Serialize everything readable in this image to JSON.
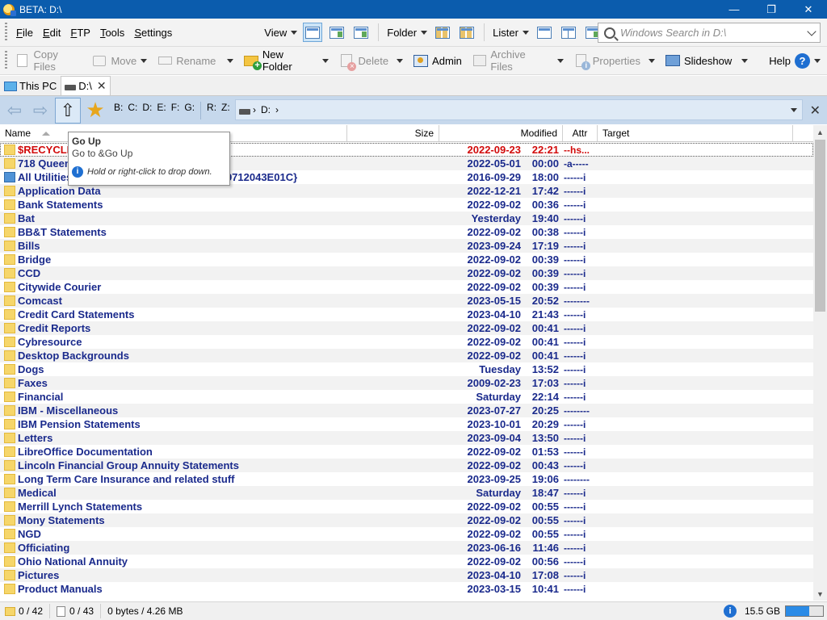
{
  "window": {
    "title": "BETA: D:\\",
    "controls": [
      "—",
      "❐",
      "✕"
    ]
  },
  "menu": {
    "items": [
      {
        "label": "File",
        "hot": "F",
        "rest": "ile"
      },
      {
        "label": "Edit",
        "hot": "E",
        "rest": "dit"
      },
      {
        "label": "FTP",
        "hot": "F",
        "rest": "TP"
      },
      {
        "label": "Tools",
        "hot": "T",
        "rest": "ools"
      },
      {
        "label": "Settings",
        "hot": "S",
        "rest": "ettings"
      }
    ],
    "view_label": "View",
    "folder_label": "Folder",
    "lister_label": "Lister",
    "search_placeholder": "Windows Search in D:\\"
  },
  "operations": {
    "copy": "Copy Files",
    "move": "Move",
    "rename": "Rename",
    "new_folder": "New Folder",
    "delete": "Delete",
    "admin": "Admin",
    "archive": "Archive Files",
    "properties": "Properties",
    "slideshow": "Slideshow",
    "help": "Help"
  },
  "tabs": [
    {
      "label": "This PC",
      "icon": "pc-icon",
      "active": false
    },
    {
      "label": "D:\\",
      "icon": "drive-icon",
      "active": true
    }
  ],
  "location": {
    "drives": [
      "B:",
      "C:",
      "D:",
      "E:",
      "F:",
      "G:",
      "R:",
      "Z:"
    ],
    "path": "D:"
  },
  "columns": {
    "name": "Name",
    "size": "Size",
    "modified": "Modified",
    "attr": "Attr",
    "target": "Target"
  },
  "tooltip": {
    "title": "Go Up",
    "subtitle": "Go to &Go Up",
    "hint": "Hold or right-click to drop down."
  },
  "files": [
    {
      "name": "$RECYCLE.BIN",
      "date": "2022-09-23",
      "time": "22:21",
      "attr": "--hs...",
      "kind": "recycle"
    },
    {
      "name": "718 Queen",
      "date": "2022-05-01",
      "time": "00:00",
      "attr": "-a-----",
      "kind": "folder"
    },
    {
      "name": "All Utilities.{ED7BA470-8E54-465E-825C-99712043E01C}",
      "date": "2016-09-29",
      "time": "18:00",
      "attr": "------i",
      "kind": "system"
    },
    {
      "name": "Application Data",
      "date": "2022-12-21",
      "time": "17:42",
      "attr": "------i",
      "kind": "folder"
    },
    {
      "name": "Bank Statements",
      "date": "2022-09-02",
      "time": "00:36",
      "attr": "------i",
      "kind": "folder"
    },
    {
      "name": "Bat",
      "date": "Yesterday",
      "time": "19:40",
      "attr": "------i",
      "kind": "folder"
    },
    {
      "name": "BB&T Statements",
      "date": "2022-09-02",
      "time": "00:38",
      "attr": "------i",
      "kind": "folder"
    },
    {
      "name": "Bills",
      "date": "2023-09-24",
      "time": "17:19",
      "attr": "------i",
      "kind": "folder"
    },
    {
      "name": "Bridge",
      "date": "2022-09-02",
      "time": "00:39",
      "attr": "------i",
      "kind": "folder"
    },
    {
      "name": "CCD",
      "date": "2022-09-02",
      "time": "00:39",
      "attr": "------i",
      "kind": "folder"
    },
    {
      "name": "Citywide Courier",
      "date": "2022-09-02",
      "time": "00:39",
      "attr": "------i",
      "kind": "folder"
    },
    {
      "name": "Comcast",
      "date": "2023-05-15",
      "time": "20:52",
      "attr": "--------",
      "kind": "folder"
    },
    {
      "name": "Credit Card Statements",
      "date": "2023-04-10",
      "time": "21:43",
      "attr": "------i",
      "kind": "folder"
    },
    {
      "name": "Credit Reports",
      "date": "2022-09-02",
      "time": "00:41",
      "attr": "------i",
      "kind": "folder"
    },
    {
      "name": "Cybresource",
      "date": "2022-09-02",
      "time": "00:41",
      "attr": "------i",
      "kind": "folder"
    },
    {
      "name": "Desktop Backgrounds",
      "date": "2022-09-02",
      "time": "00:41",
      "attr": "------i",
      "kind": "folder"
    },
    {
      "name": "Dogs",
      "date": "Tuesday",
      "time": "13:52",
      "attr": "------i",
      "kind": "folder"
    },
    {
      "name": "Faxes",
      "date": "2009-02-23",
      "time": "17:03",
      "attr": "------i",
      "kind": "folder"
    },
    {
      "name": "Financial",
      "date": "Saturday",
      "time": "22:14",
      "attr": "------i",
      "kind": "folder"
    },
    {
      "name": "IBM - Miscellaneous",
      "date": "2023-07-27",
      "time": "20:25",
      "attr": "--------",
      "kind": "folder"
    },
    {
      "name": "IBM Pension Statements",
      "date": "2023-10-01",
      "time": "20:29",
      "attr": "------i",
      "kind": "folder"
    },
    {
      "name": "Letters",
      "date": "2023-09-04",
      "time": "13:50",
      "attr": "------i",
      "kind": "folder"
    },
    {
      "name": "LibreOffice Documentation",
      "date": "2022-09-02",
      "time": "01:53",
      "attr": "------i",
      "kind": "folder"
    },
    {
      "name": "Lincoln Financial Group Annuity Statements",
      "date": "2022-09-02",
      "time": "00:43",
      "attr": "------i",
      "kind": "folder"
    },
    {
      "name": "Long Term Care Insurance and related stuff",
      "date": "2023-09-25",
      "time": "19:06",
      "attr": "--------",
      "kind": "folder"
    },
    {
      "name": "Medical",
      "date": "Saturday",
      "time": "18:47",
      "attr": "------i",
      "kind": "folder"
    },
    {
      "name": "Merrill Lynch Statements",
      "date": "2022-09-02",
      "time": "00:55",
      "attr": "------i",
      "kind": "folder"
    },
    {
      "name": "Mony Statements",
      "date": "2022-09-02",
      "time": "00:55",
      "attr": "------i",
      "kind": "folder"
    },
    {
      "name": "NGD",
      "date": "2022-09-02",
      "time": "00:55",
      "attr": "------i",
      "kind": "folder"
    },
    {
      "name": "Officiating",
      "date": "2023-06-16",
      "time": "11:46",
      "attr": "------i",
      "kind": "folder"
    },
    {
      "name": "Ohio National Annuity",
      "date": "2022-09-02",
      "time": "00:56",
      "attr": "------i",
      "kind": "folder"
    },
    {
      "name": "Pictures",
      "date": "2023-04-10",
      "time": "17:08",
      "attr": "------i",
      "kind": "folder"
    },
    {
      "name": "Product Manuals",
      "date": "2023-03-15",
      "time": "10:41",
      "attr": "------i",
      "kind": "folder"
    }
  ],
  "status": {
    "folders": "0 / 42",
    "files": "0 / 43",
    "bytes": "0 bytes / 4.26 MB",
    "free": "15.5 GB",
    "used_fraction": 0.62
  }
}
